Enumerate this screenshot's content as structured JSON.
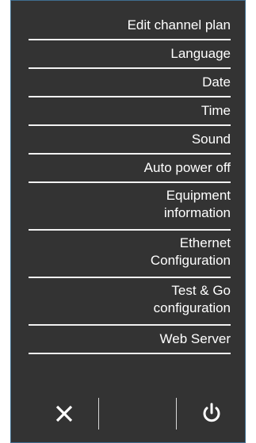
{
  "menu": {
    "items": [
      {
        "label": "Edit channel plan"
      },
      {
        "label": "Language"
      },
      {
        "label": "Date"
      },
      {
        "label": "Time"
      },
      {
        "label": "Sound"
      },
      {
        "label": "Auto power off"
      },
      {
        "line1": "Equipment",
        "line2": "information"
      },
      {
        "line1": "Ethernet",
        "line2": "Configuration"
      },
      {
        "line1": "Test & Go",
        "line2": "configuration"
      },
      {
        "label": "Web Server"
      }
    ]
  },
  "icons": {
    "close": "close-icon",
    "power": "power-icon"
  },
  "colors": {
    "panel_bg": "#333333",
    "panel_border": "#3f6e8f",
    "text": "#ffffff",
    "divider": "#f2f2f2"
  }
}
